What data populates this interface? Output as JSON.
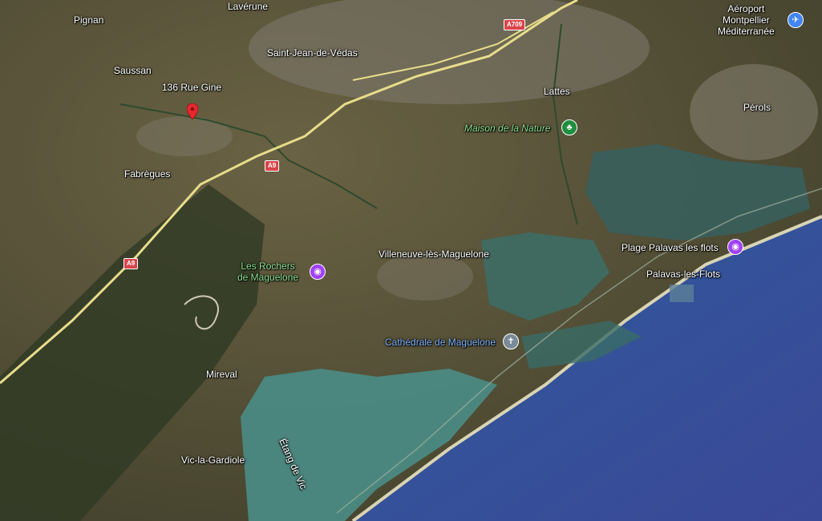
{
  "map": {
    "type": "satellite",
    "colors": {
      "land": "#5b5536",
      "sea": "#3a4c9a",
      "shallow_sea": "#2e7f8a",
      "lagoon": "#4a8d86",
      "road": "#e7dd8b",
      "shield": "#d9454a",
      "pin": "#e8282e"
    }
  },
  "marker": {
    "label": "136 Rue Gine",
    "icon": "map-pin-icon"
  },
  "places": {
    "pignan": "Pignan",
    "laverune": "Lavérune",
    "saussan": "Saussan",
    "saint_jean": "Saint-Jean-de-Védas",
    "lattes": "Lattes",
    "fabregues": "Fabrègues",
    "perols": "Pérols",
    "villeneuve": "Villeneuve-lès-Maguelone",
    "palavas": "Palavas-les-Flots",
    "mireval": "Mireval",
    "vic": "Vic-la-Gardiole",
    "etang_vic": "Étang de Vic"
  },
  "pois": {
    "airport": {
      "label_line1": "Aéroport",
      "label_line2": "Montpellier",
      "label_line3": "Méditerranée",
      "icon": "airplane-icon",
      "color": "#4285f4"
    },
    "maison_nature": {
      "label": "Maison de la Nature",
      "icon": "tree-icon",
      "color": "#1e8e3e"
    },
    "rochers": {
      "label_line1": "Les Rochers",
      "label_line2": "de Maguelone",
      "icon": "camera-icon",
      "color": "#a142f4"
    },
    "plage": {
      "label": "Plage Palavas les flots",
      "icon": "camera-icon",
      "color": "#a142f4"
    },
    "cathedrale": {
      "label": "Cathédrale de Maguelone",
      "icon": "cross-icon",
      "color": "#7b8a99"
    }
  },
  "roads": {
    "a709": "A709",
    "a9_upper": "A9",
    "a9_lower": "A9"
  }
}
